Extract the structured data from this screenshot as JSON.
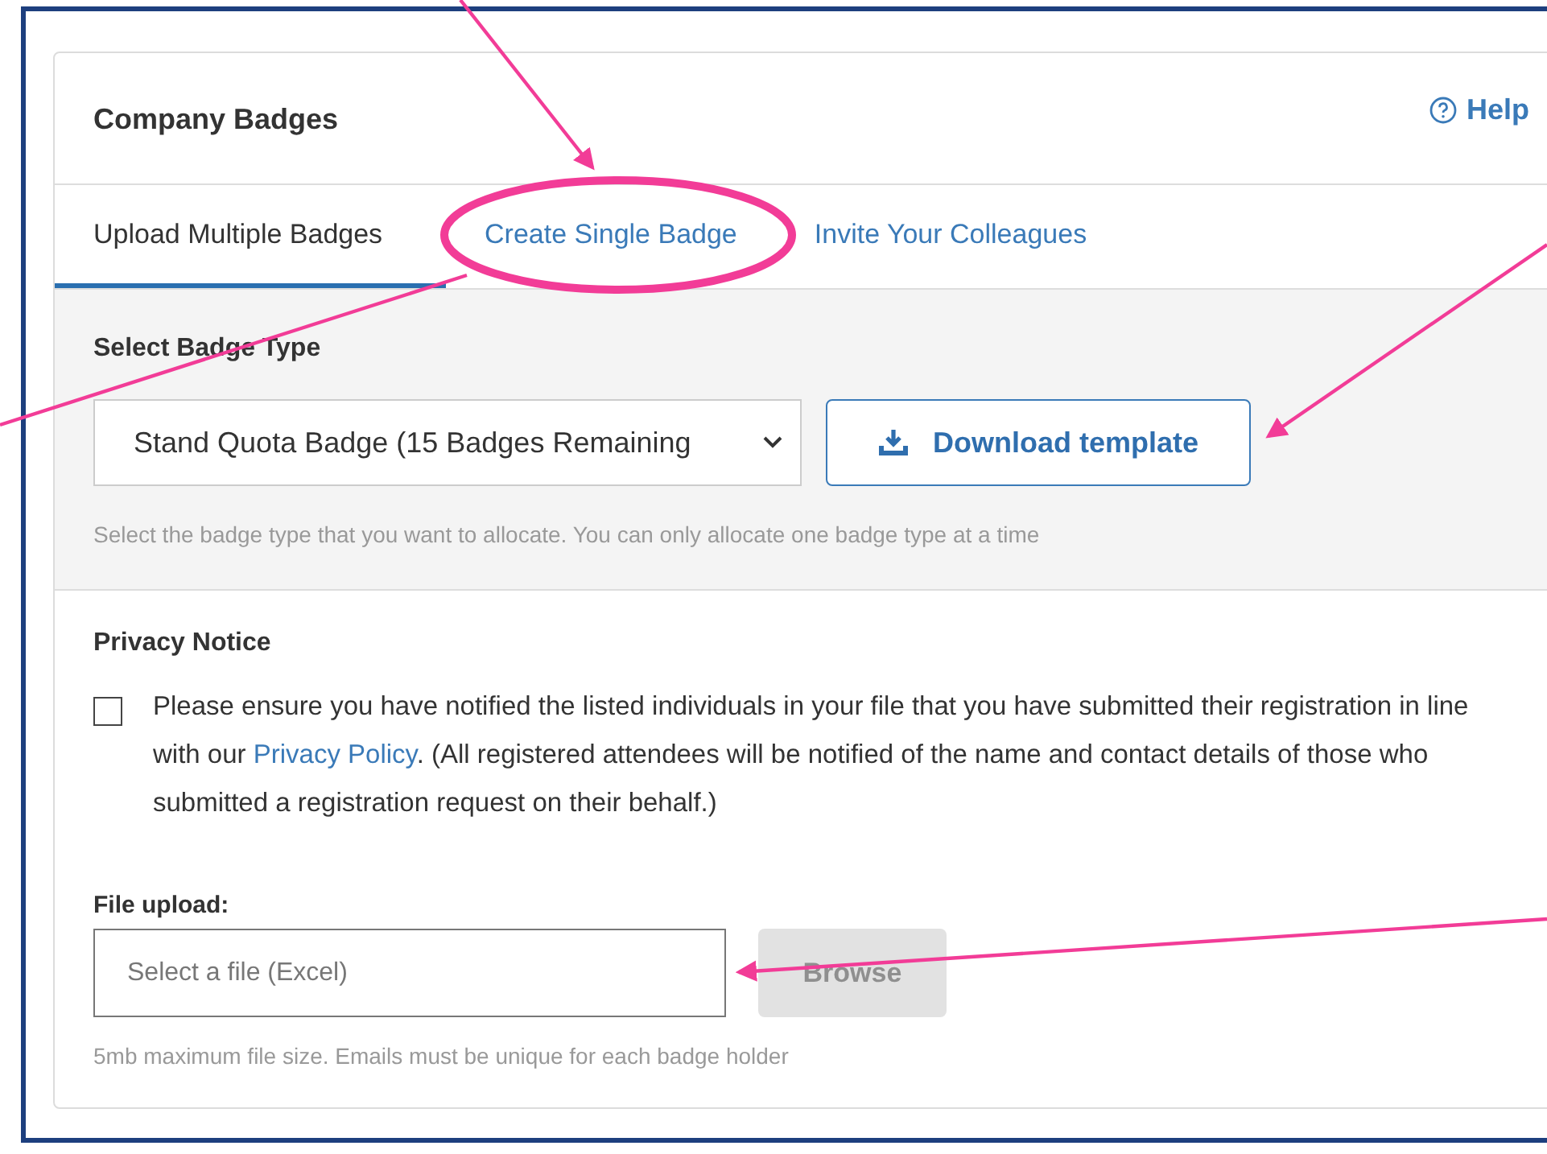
{
  "card": {
    "title": "Company Badges",
    "help": "Help"
  },
  "tabs": [
    {
      "label": "Upload Multiple Badges",
      "selected": true
    },
    {
      "label": "Create Single Badge",
      "selected": false
    },
    {
      "label": "Invite Your Colleagues",
      "selected": false
    }
  ],
  "badge_type": {
    "label": "Select Badge Type",
    "value": "Stand Quota Badge (15 Badges Remaining",
    "button": "Download template",
    "hint": "Select the badge type that you want to allocate. You can only allocate one badge type at a time"
  },
  "privacy": {
    "title": "Privacy Notice",
    "checked": false,
    "text_before": "Please ensure you have notified the listed individuals in your file that you have submitted their registration in line with our ",
    "link": "Privacy Policy",
    "text_after": ". (All registered attendees will be notified of the name and contact details of those who submitted a registration request on their behalf.)"
  },
  "file_upload": {
    "label": "File upload:",
    "placeholder": "Select a file (Excel)",
    "button": "Browse",
    "button_disabled": true,
    "hint": "5mb maximum file size. Emails must be unique for each badge holder"
  }
}
